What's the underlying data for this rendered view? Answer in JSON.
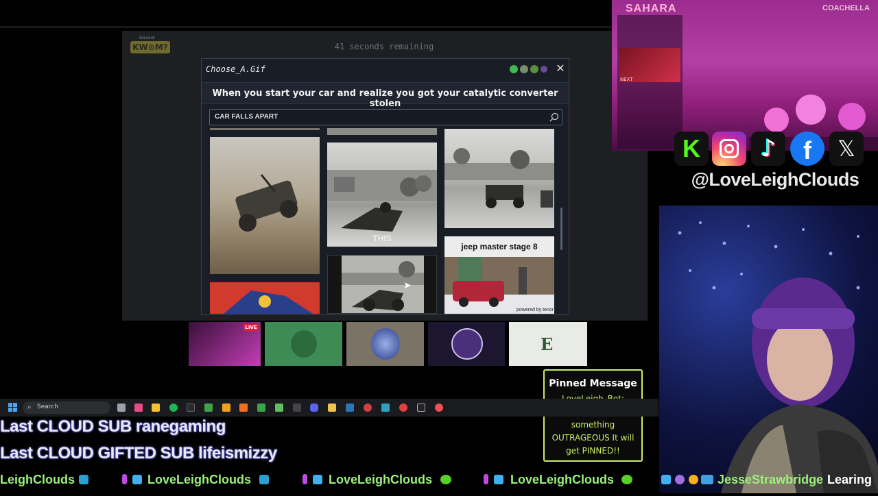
{
  "activity": {
    "badge": "KW⊙M?",
    "badge_caption": "Discord",
    "timer": "41 seconds remaining"
  },
  "dialog": {
    "title": "Choose_A.Gif",
    "prompt": "When you start your car and realize you got your catalytic converter stolen",
    "search_value": "CAR FALLS APART",
    "gifs": [
      {
        "id": "gif-jeep-flip",
        "caption": ""
      },
      {
        "id": "gif-bw-crash",
        "caption": "THIS"
      },
      {
        "id": "gif-bw-car-road",
        "caption": ""
      },
      {
        "id": "gif-jeep-master",
        "caption": "jeep master stage 8"
      },
      {
        "id": "gif-bw-wreck",
        "caption": ""
      },
      {
        "id": "gif-cartoon",
        "caption": ""
      }
    ],
    "tenor_label": "powered by tenor"
  },
  "stage": {
    "name": "SAHARA",
    "festival": "COACHELLA",
    "next_label": "NEXT"
  },
  "socials": {
    "handle": "@LoveLeighClouds"
  },
  "pinned": {
    "title": "Pinned Message",
    "body": "LoveLeigh_Bot: WARNING If you say something OUTRAGEOUS It will get PINNED!!"
  },
  "taskbar": {
    "search_label": "Search"
  },
  "banners": {
    "last_sub": "Last CLOUD SUB ranegaming",
    "last_gifted": "Last CLOUD GIFTED SUB lifeismizzy"
  },
  "ticker": {
    "items": [
      "LeighClouds",
      "LoveLeighClouds",
      "LoveLeighClouds",
      "LoveLeighClouds"
    ],
    "follower": "JesseStrawbridge",
    "follower_suffix": "Learing"
  },
  "colors": {
    "accent_green": "#c9ee66",
    "ticker_green": "#9af27a",
    "dialog_bg": "#191d26"
  }
}
